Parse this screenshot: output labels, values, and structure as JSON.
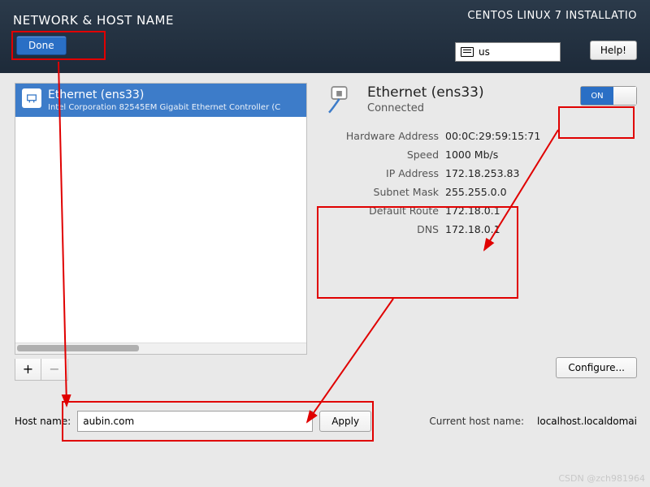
{
  "header": {
    "title": "NETWORK & HOST NAME",
    "done_label": "Done",
    "installer": "CENTOS LINUX 7 INSTALLATIO",
    "lang": "us",
    "help_label": "Help!"
  },
  "interface_list": {
    "items": [
      {
        "name": "Ethernet (ens33)",
        "desc": "Intel Corporation 82545EM Gigabit Ethernet Controller (C"
      }
    ]
  },
  "buttons": {
    "plus": "+",
    "minus": "−",
    "configure": "Configure...",
    "apply": "Apply"
  },
  "detail": {
    "title": "Ethernet (ens33)",
    "status": "Connected",
    "switch_on": "ON",
    "rows": {
      "hwaddr_lbl": "Hardware Address",
      "hwaddr": "00:0C:29:59:15:71",
      "speed_lbl": "Speed",
      "speed": "1000 Mb/s",
      "ip_lbl": "IP Address",
      "ip": "172.18.253.83",
      "mask_lbl": "Subnet Mask",
      "mask": "255.255.0.0",
      "route_lbl": "Default Route",
      "route": "172.18.0.1",
      "dns_lbl": "DNS",
      "dns": "172.18.0.1"
    }
  },
  "hostname": {
    "label": "Host name:",
    "value": "aubin.com",
    "current_label": "Current host name:",
    "current_value": "localhost.localdomai"
  },
  "watermark": "CSDN @zch981964"
}
